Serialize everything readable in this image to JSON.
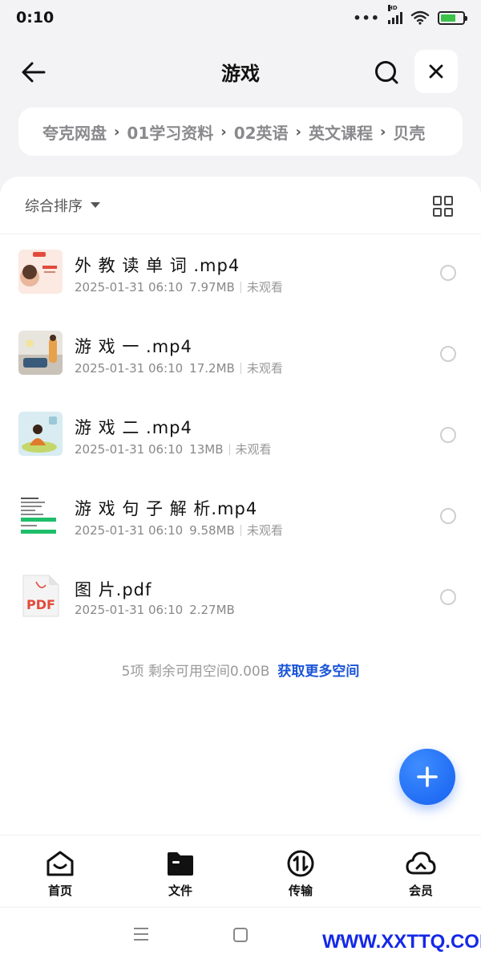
{
  "status_bar": {
    "time": "0:10",
    "dots": "•••",
    "network": "HD"
  },
  "header": {
    "title": "游戏"
  },
  "breadcrumb": [
    "夸克网盘",
    "01学习资料",
    "02英语",
    "英文课程",
    "贝壳"
  ],
  "sort": {
    "label": "综合排序"
  },
  "files": [
    {
      "name": "外 教 读 单 词 .mp4",
      "date": "2025-01-31 06:10",
      "size": "7.97MB",
      "watched": "未观看",
      "thumb": "video-word"
    },
    {
      "name": "游 戏 一 .mp4",
      "date": "2025-01-31 06:10",
      "size": "17.2MB",
      "watched": "未观看",
      "thumb": "video-room"
    },
    {
      "name": "游 戏 二 .mp4",
      "date": "2025-01-31 06:10",
      "size": "13MB",
      "watched": "未观看",
      "thumb": "video-cartoon"
    },
    {
      "name": "游 戏 句 子 解 析.mp4",
      "date": "2025-01-31 06:10",
      "size": "9.58MB",
      "watched": "未观看",
      "thumb": "video-text"
    },
    {
      "name": "图 片.pdf",
      "date": "2025-01-31 06:10",
      "size": "2.27MB",
      "watched": "",
      "thumb": "pdf",
      "badge": "PDF"
    }
  ],
  "footer": {
    "info": "5项 剩余可用空间0.00B",
    "link": "获取更多空间"
  },
  "bottom_nav": [
    {
      "label": "首页",
      "icon": "home-icon"
    },
    {
      "label": "文件",
      "icon": "folder-icon"
    },
    {
      "label": "传输",
      "icon": "transfer-icon"
    },
    {
      "label": "会员",
      "icon": "cloud-icon"
    }
  ],
  "watermark": "WWW.XXTTQ.COM",
  "colors": {
    "accent": "#1a54d8",
    "fab": "#1560f0",
    "battery": "#3cc24b"
  }
}
